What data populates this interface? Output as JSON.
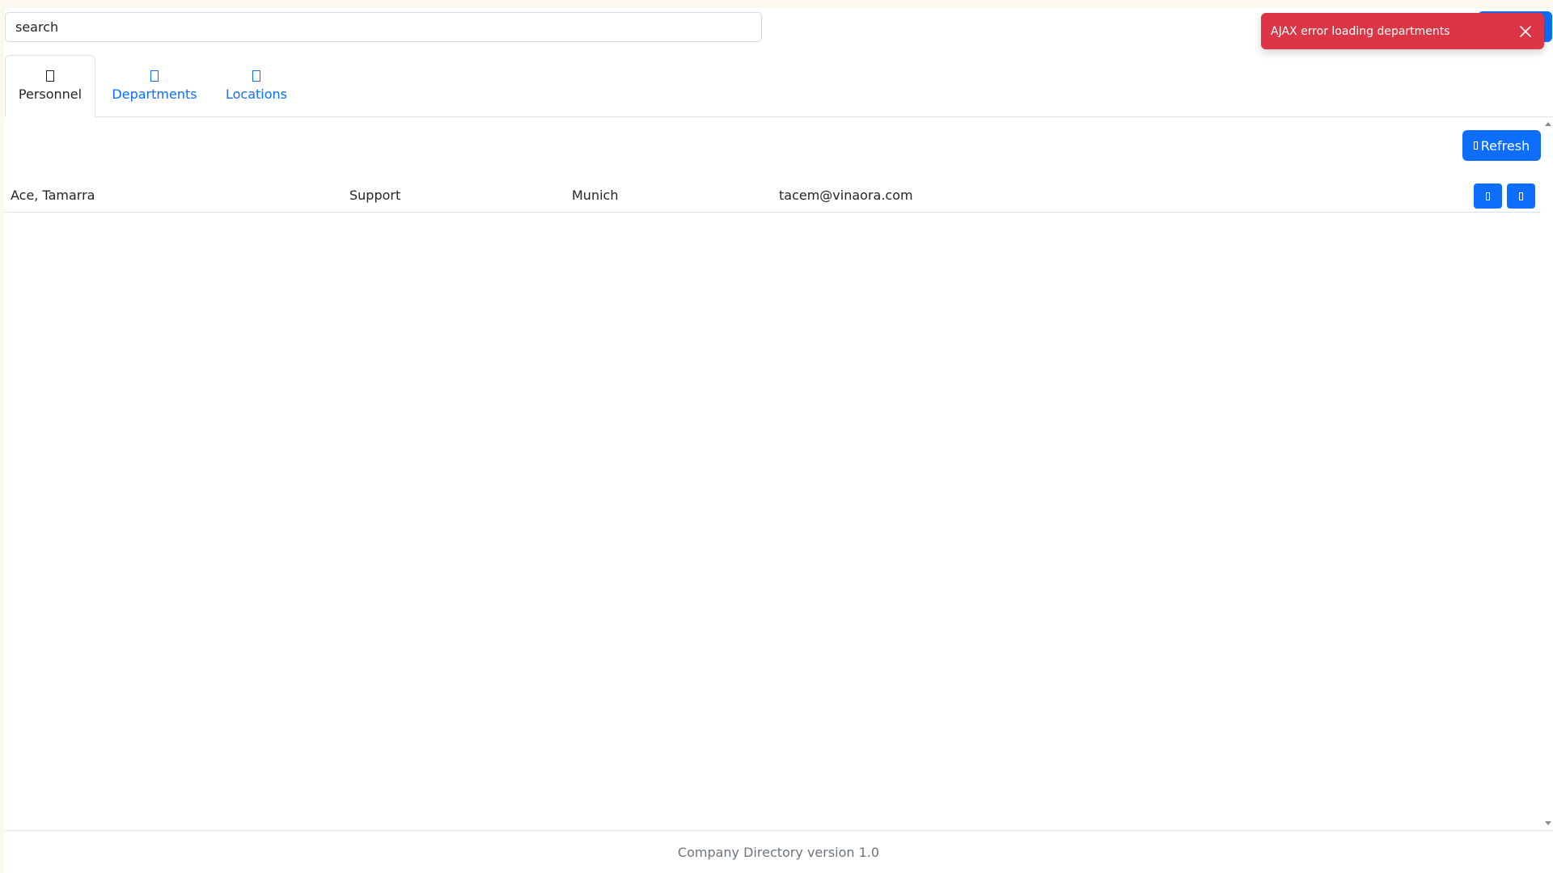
{
  "search": {
    "placeholder": "search",
    "value": ""
  },
  "toast": {
    "message": "AJAX error loading departments",
    "color": "#dc3545"
  },
  "tabs": [
    {
      "label": "Personnel",
      "icon": "person-icon",
      "active": true
    },
    {
      "label": "Departments",
      "icon": "building-icon",
      "active": false
    },
    {
      "label": "Locations",
      "icon": "map-pin-icon",
      "active": false
    }
  ],
  "toolbar": {
    "refresh_label": "Refresh"
  },
  "personnel": [
    {
      "name": "Ace, Tamarra",
      "department": "Support",
      "location": "Munich",
      "email": "tacem@vinaora.com"
    }
  ],
  "footer": {
    "text": "Company Directory version 1.0"
  },
  "colors": {
    "primary": "#0d6efd",
    "danger": "#dc3545",
    "muted": "#6c757d"
  }
}
